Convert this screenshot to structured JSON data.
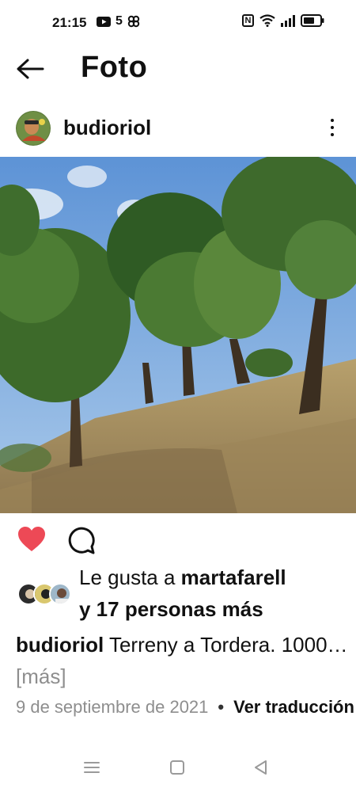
{
  "status_bar": {
    "time": "21:15",
    "left_icons": [
      "youtube-icon",
      "channel-5-icon",
      "pinwheel-icon"
    ],
    "channel_label": "5",
    "right_icons": [
      "nfc-icon",
      "wifi-icon",
      "signal-icon",
      "battery-icon"
    ],
    "nfc_label": "N"
  },
  "header": {
    "title": "Foto",
    "back_icon": "back-arrow-icon"
  },
  "post": {
    "username": "budioriol",
    "more_icon": "more-vertical-icon",
    "photo_icon": "landscape-photo"
  },
  "actions": {
    "like_icon": "heart-icon",
    "like_color": "#ed4956",
    "comment_icon": "comment-icon"
  },
  "likes": {
    "prefix": "Le gusta a ",
    "user": "martafarell",
    "line2": "y 17 personas más"
  },
  "caption": {
    "username": "budioriol",
    "text": " Terreny a Tordera. 1000…",
    "more": " [más]"
  },
  "meta": {
    "date": "9 de septiembre de 2021",
    "separator": "•",
    "translate": "Ver traducción"
  },
  "nav_bar": {
    "icons": [
      "menu-icon",
      "home-square-icon",
      "back-triangle-icon"
    ]
  }
}
